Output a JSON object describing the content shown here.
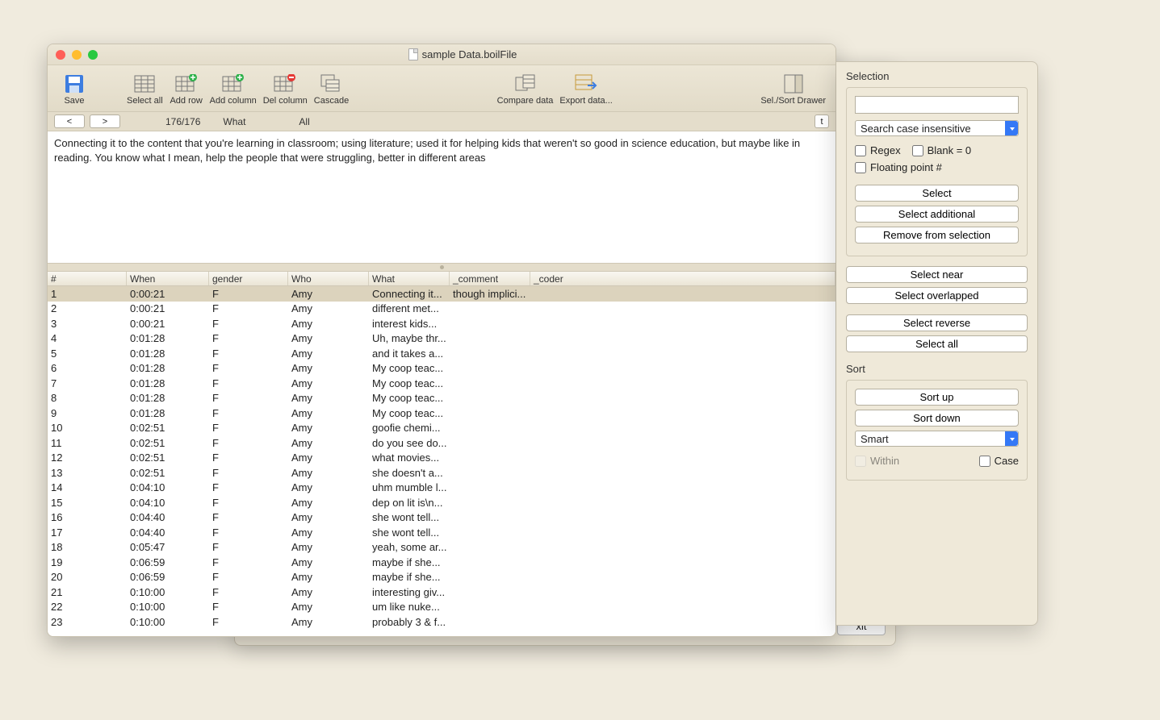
{
  "window": {
    "title": "sample Data.boilFile"
  },
  "bg": {
    "exit": "xit"
  },
  "toolbar": {
    "save": "Save",
    "select_all": "Select all",
    "add_row": "Add row",
    "add_column": "Add column",
    "del_column": "Del column",
    "cascade": "Cascade",
    "compare": "Compare data",
    "export": "Export data...",
    "drawer": "Sel./Sort Drawer"
  },
  "nav": {
    "prev": "<",
    "next": ">",
    "counter": "176/176",
    "field": "What",
    "scope": "All",
    "t": "t"
  },
  "textpane": "Connecting it  to the content that you're learning in classroom; using literature; used it for helping kids that weren't so good in science education, but maybe like in reading. You know what I mean, help the people that were struggling, better in different areas",
  "columns": [
    "#",
    "When",
    "gender",
    "Who",
    "What",
    "_comment",
    "_coder"
  ],
  "rows": [
    {
      "n": "1",
      "when": "0:00:21",
      "gender": "F",
      "who": "Amy",
      "what": "Connecting it...",
      "comment": "though implici...",
      "coder": ""
    },
    {
      "n": "2",
      "when": "0:00:21",
      "gender": "F",
      "who": "Amy",
      "what": "different met...",
      "comment": "",
      "coder": ""
    },
    {
      "n": "3",
      "when": "0:00:21",
      "gender": "F",
      "who": "Amy",
      "what": "interest kids...",
      "comment": "",
      "coder": ""
    },
    {
      "n": "4",
      "when": "0:01:28",
      "gender": "F",
      "who": "Amy",
      "what": "Uh, maybe thr...",
      "comment": "",
      "coder": ""
    },
    {
      "n": "5",
      "when": "0:01:28",
      "gender": "F",
      "who": "Amy",
      "what": " and it takes a...",
      "comment": "",
      "coder": ""
    },
    {
      "n": "6",
      "when": "0:01:28",
      "gender": "F",
      "who": "Amy",
      "what": "My coop teac...",
      "comment": "",
      "coder": ""
    },
    {
      "n": "7",
      "when": "0:01:28",
      "gender": "F",
      "who": "Amy",
      "what": "My coop teac...",
      "comment": "",
      "coder": ""
    },
    {
      "n": "8",
      "when": "0:01:28",
      "gender": "F",
      "who": "Amy",
      "what": "My coop teac...",
      "comment": "",
      "coder": ""
    },
    {
      "n": "9",
      "when": "0:01:28",
      "gender": "F",
      "who": "Amy",
      "what": "My coop teac...",
      "comment": "",
      "coder": ""
    },
    {
      "n": "10",
      "when": "0:02:51",
      "gender": "F",
      "who": "Amy",
      "what": " goofie chemi...",
      "comment": "",
      "coder": ""
    },
    {
      "n": "11",
      "when": "0:02:51",
      "gender": "F",
      "who": "Amy",
      "what": "do you see do...",
      "comment": "",
      "coder": ""
    },
    {
      "n": "12",
      "when": "0:02:51",
      "gender": "F",
      "who": "Amy",
      "what": "what movies...",
      "comment": "",
      "coder": ""
    },
    {
      "n": "13",
      "when": "0:02:51",
      "gender": "F",
      "who": "Amy",
      "what": "she doesn't a...",
      "comment": "",
      "coder": ""
    },
    {
      "n": "14",
      "when": "0:04:10",
      "gender": "F",
      "who": "Amy",
      "what": "uhm mumble l...",
      "comment": "",
      "coder": ""
    },
    {
      "n": "15",
      "when": "0:04:10",
      "gender": "F",
      "who": "Amy",
      "what": "dep on lit is\\n...",
      "comment": "",
      "coder": ""
    },
    {
      "n": "16",
      "when": "0:04:40",
      "gender": "F",
      "who": "Amy",
      "what": "she wont tell...",
      "comment": "",
      "coder": ""
    },
    {
      "n": "17",
      "when": "0:04:40",
      "gender": "F",
      "who": "Amy",
      "what": "she wont tell...",
      "comment": "",
      "coder": ""
    },
    {
      "n": "18",
      "when": "0:05:47",
      "gender": "F",
      "who": "Amy",
      "what": "yeah, some ar...",
      "comment": "",
      "coder": ""
    },
    {
      "n": "19",
      "when": "0:06:59",
      "gender": "F",
      "who": "Amy",
      "what": "maybe if she...",
      "comment": "",
      "coder": ""
    },
    {
      "n": "20",
      "when": "0:06:59",
      "gender": "F",
      "who": "Amy",
      "what": "maybe if she...",
      "comment": "",
      "coder": ""
    },
    {
      "n": "21",
      "when": "0:10:00",
      "gender": "F",
      "who": "Amy",
      "what": "interesting giv...",
      "comment": "",
      "coder": ""
    },
    {
      "n": "22",
      "when": "0:10:00",
      "gender": "F",
      "who": "Amy",
      "what": "um like nuke...",
      "comment": "",
      "coder": ""
    },
    {
      "n": "23",
      "when": "0:10:00",
      "gender": "F",
      "who": "Amy",
      "what": "probably 3 & f...",
      "comment": "",
      "coder": ""
    }
  ],
  "drawer": {
    "selection_title": "Selection",
    "search_mode": "Search case insensitive",
    "regex": "Regex",
    "blank0": "Blank = 0",
    "float": "Floating point #",
    "select": "Select",
    "select_additional": "Select additional",
    "remove": "Remove from selection",
    "select_near": "Select near",
    "select_overlapped": "Select overlapped",
    "select_reverse": "Select reverse",
    "select_all": "Select all",
    "sort_title": "Sort",
    "sort_up": "Sort up",
    "sort_down": "Sort down",
    "sort_mode": "Smart",
    "within": "Within",
    "case": "Case"
  }
}
